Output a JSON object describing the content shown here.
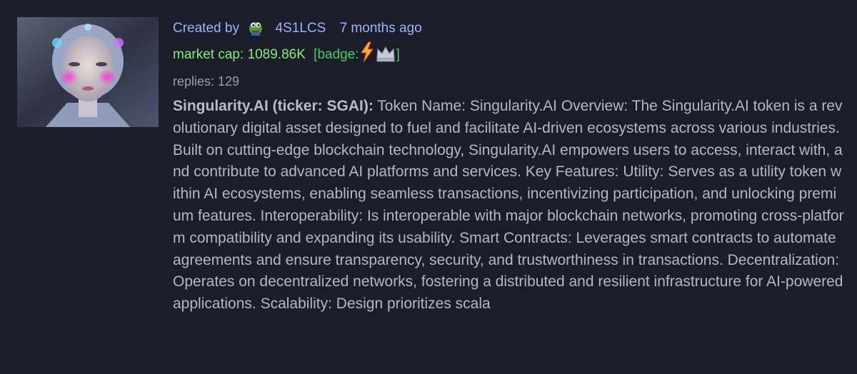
{
  "post": {
    "created_by_label": "Created by",
    "username": "4S1LCS",
    "time_ago": "7 months ago",
    "market_cap": "market cap: 1089.86K",
    "badge_label": "[badge:",
    "badge_close": "]",
    "badges": [
      "lightning-icon",
      "crown-icon"
    ],
    "replies": "replies: 129",
    "token_title": "Singularity.AI (ticker: SGAI):",
    "description": " Token Name: Singularity.AI Overview: The Singularity.AI token is a revolutionary digital asset designed to fuel and facilitate AI-driven ecosystems across various industries. Built on cutting-edge blockchain technology, Singularity.AI empowers users to access, interact with, and contribute to advanced AI platforms and services. Key Features: Utility: Serves as a utility token within AI ecosystems, enabling seamless transactions, incentivizing participation, and unlocking premium features. Interoperability: Is interoperable with major blockchain networks, promoting cross-platform compatibility and expanding its usability. Smart Contracts: Leverages smart contracts to automate agreements and ensure transparency, security, and trustworthiness in transactions. Decentralization: Operates on decentralized networks, fostering a distributed and resilient infrastructure for AI-powered applications. Scalability: Design prioritizes scala",
    "colors": {
      "background": "#1b1d28",
      "username": "#9fb3ff",
      "market_cap": "#7ef07e",
      "badge": "#3ecf6a",
      "text": "#b4b8c4"
    }
  }
}
